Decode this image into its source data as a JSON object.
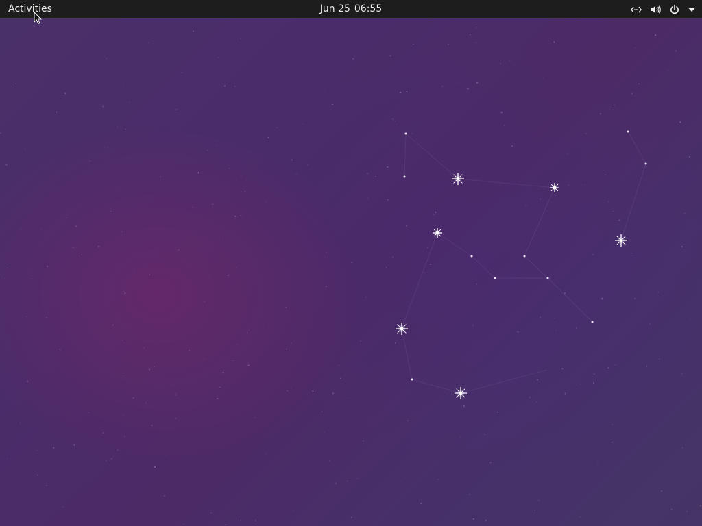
{
  "topbar": {
    "activities_label": "Activities",
    "clock": {
      "date": "Jun 25",
      "time": "06:55"
    },
    "status_icons": [
      "network-wired-icon",
      "volume-icon",
      "power-icon",
      "chevron-down-icon"
    ],
    "background_color": "#1d1d1d",
    "text_color": "#eeeeec"
  },
  "desktop": {
    "wallpaper": "purple starry night with constellation",
    "colors": {
      "base": "#4a2d68",
      "magenta_glow": "#782669",
      "star": "#ffffff"
    }
  }
}
